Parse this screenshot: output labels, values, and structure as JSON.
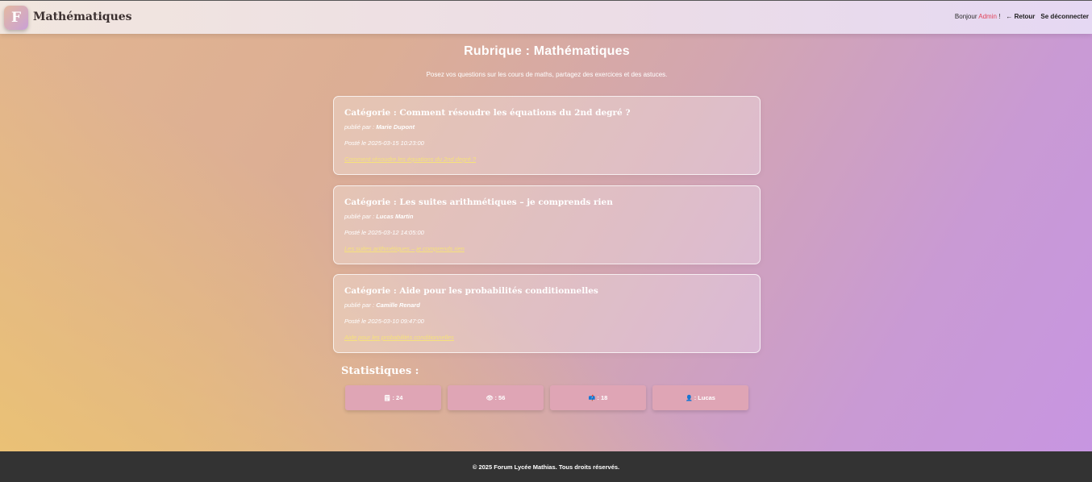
{
  "header": {
    "logo_letter": "F",
    "site_title": "Mathématiques",
    "greeting_prefix": "Bonjour",
    "username": "Admin",
    "greeting_suffix": "!",
    "back_label": "← Retour",
    "logout_label": "Se déconnecter"
  },
  "main": {
    "title": "Rubrique : Mathématiques",
    "description": "Posez vos questions sur les cours de maths, partagez des exercices et des astuces."
  },
  "posts": [
    {
      "title": "Catégorie : Comment résoudre les équations du 2nd degré ?",
      "author_prefix": "publié par :",
      "author": "Marie Dupont",
      "date": "Posté le 2025-03-15 10:23:00",
      "link": "Comment résoudre les équations du 2nd degré ?"
    },
    {
      "title": "Catégorie : Les suites arithmétiques – je comprends rien",
      "author_prefix": "publié par :",
      "author": "Lucas Martin",
      "date": "Posté le 2025-03-12 14:05:00",
      "link": "Les suites arithmétiques – je comprends rien"
    },
    {
      "title": "Catégorie : Aide pour les probabilités conditionnelles",
      "author_prefix": "publié par :",
      "author": "Camille Renard",
      "date": "Posté le 2025-03-10 09:47:00",
      "link": "Aide pour les probabilités conditionnelles"
    }
  ],
  "stats": {
    "title": "Statistiques :",
    "items": [
      {
        "icon": "document-icon",
        "glyph": "🗒",
        "value": ": 24"
      },
      {
        "icon": "eye-icon",
        "glyph": "👁",
        "value": ": 56"
      },
      {
        "icon": "mailbox-icon",
        "glyph": "📫",
        "value": ": 18"
      },
      {
        "icon": "user-icon",
        "glyph": "👤",
        "value": ": Lucas"
      }
    ]
  },
  "footer": {
    "text": "© 2025 Forum Lycée Mathias. Tous droits réservés."
  },
  "colors": {
    "username": "#e0445a",
    "link": "#f6e27a",
    "stat_box": "#dfa5b5",
    "footer_bg": "#333333"
  }
}
